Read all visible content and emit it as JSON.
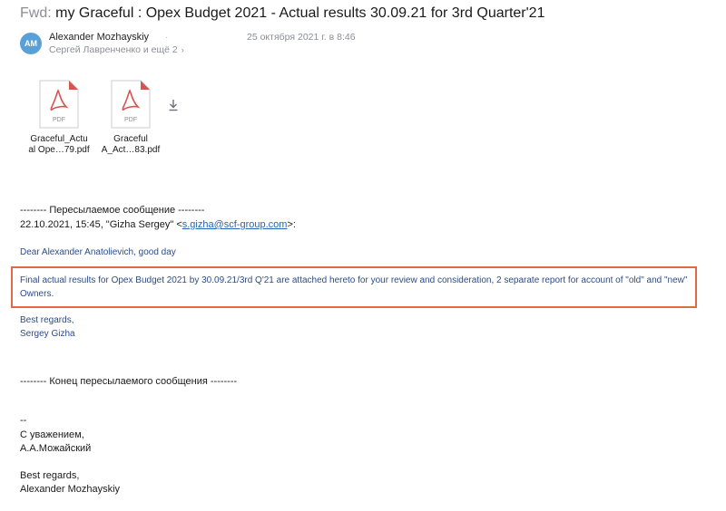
{
  "subject": {
    "prefix": "Fwd:",
    "title": "my Graceful : Opex Budget 2021 - Actual results 30.09.21 for 3rd Quarter'21"
  },
  "header": {
    "avatar_initials": "AM",
    "avatar_color": "#5aa0d8",
    "sender": "Alexander Mozhayskiy",
    "sender_separator": "·",
    "date": "25 октября 2021 г. в 8:46",
    "recipients": "Сергей Лавренченко и ещё 2",
    "recipients_chevron": "›"
  },
  "attachments": [
    {
      "type_label": "PDF",
      "name_line1": "Graceful_Actu",
      "name_line2": "al Ope…79.pdf",
      "icon": "pdf-icon"
    },
    {
      "type_label": "PDF",
      "name_line1": "Graceful",
      "name_line2": "A_Act…83.pdf",
      "icon": "pdf-icon"
    }
  ],
  "download_icon": "download-icon",
  "body": {
    "forward_header": "-------- Пересылаемое сообщение --------",
    "forward_from_prefix": "22.10.2021, 15:45, \"Gizha Sergey\" <",
    "forward_from_email": "s.gizha@scf-group.com",
    "forward_from_suffix": ">:",
    "greeting": "Dear Alexander Anatolievich, good day",
    "highlighted_paragraph": "Final actual results for Opex Budget 2021 by 30.09.21/3rd Q'21 are attached hereto for your review and consideration, 2 separate report for account of \"old\" and \"new\" Owners.",
    "regards": "Best regards,",
    "signer": "Sergey Gizha",
    "forward_end": "-------- Конец пересылаемого сообщения --------",
    "sig_dashes": "--",
    "sig_ru_regards": "С уважением,",
    "sig_ru_name": "А.А.Можайский",
    "sig_en_regards": "Best regards,",
    "sig_en_name": "Alexander Mozhayskiy"
  },
  "colors": {
    "link": "#2864b4",
    "quoted_text": "#2b4c8a",
    "highlight_border": "#e06a45",
    "pdf_red": "#d9534f"
  }
}
